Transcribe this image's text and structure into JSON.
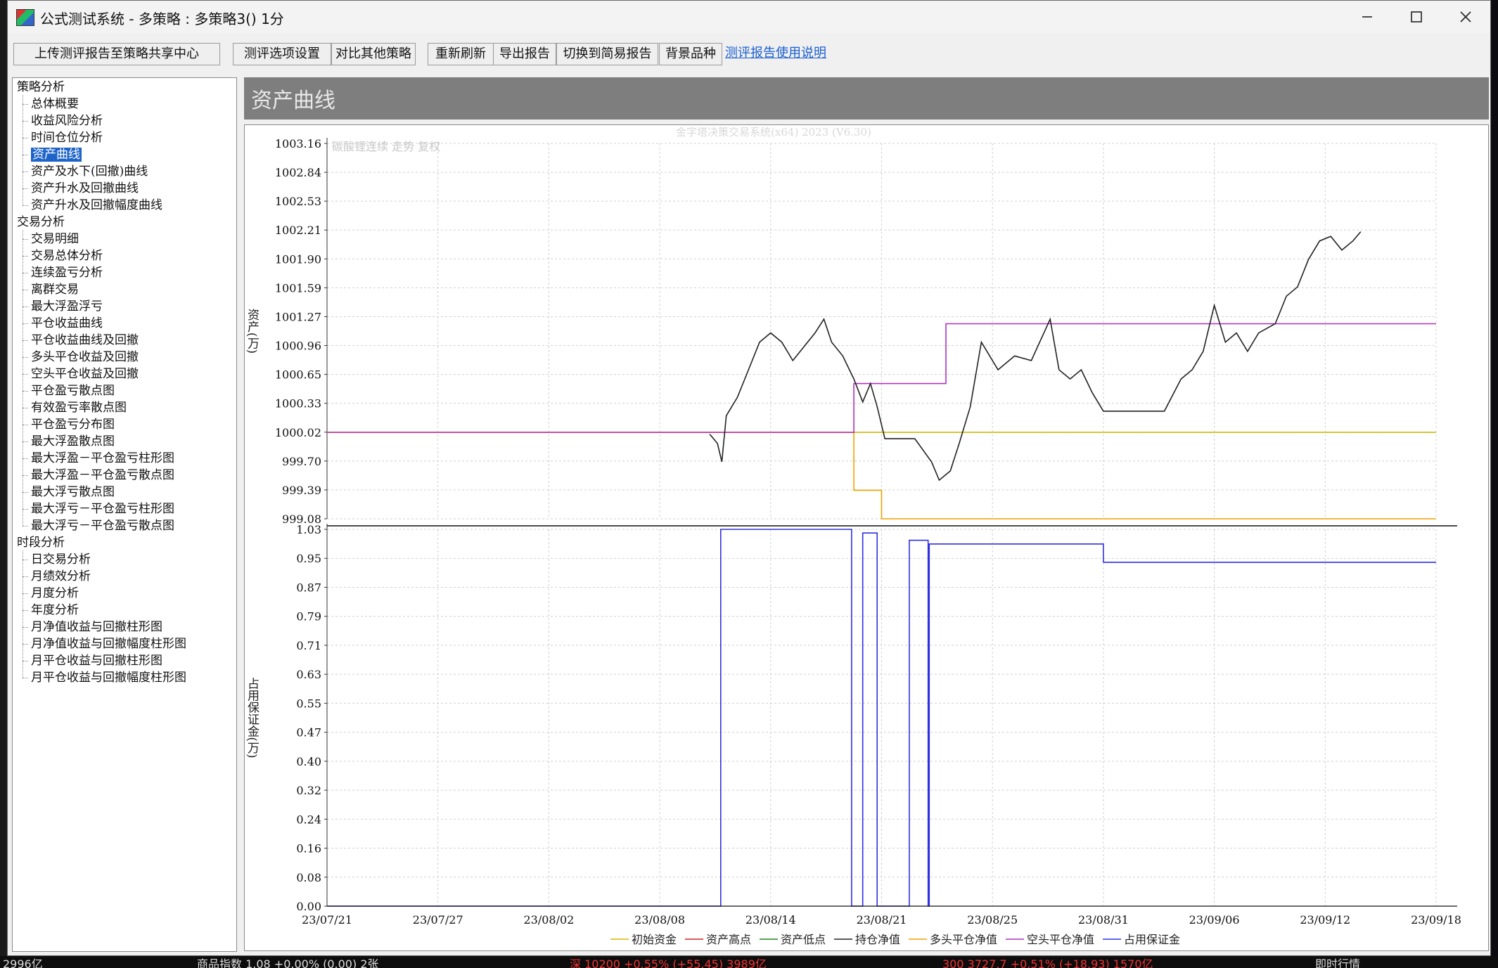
{
  "window": {
    "title": "公式测试系统 - 多策略 : 多策略3() 1分"
  },
  "toolbar": {
    "upload": "上传测评报告至策略共享中心",
    "options": "测评选项设置",
    "compare": "对比其他策略",
    "refresh": "重新刷新",
    "export": "导出报告",
    "simple": "切换到简易报告",
    "bgsymbol": "背景品种",
    "help": "测评报告使用说明"
  },
  "tree": [
    {
      "label": "策略分析",
      "level": 0
    },
    {
      "label": "总体概要",
      "level": 1
    },
    {
      "label": "收益风险分析",
      "level": 1
    },
    {
      "label": "时间仓位分析",
      "level": 1
    },
    {
      "label": "资产曲线",
      "level": 1,
      "selected": true
    },
    {
      "label": "资产及水下(回撤)曲线",
      "level": 1
    },
    {
      "label": "资产升水及回撤曲线",
      "level": 1
    },
    {
      "label": "资产升水及回撤幅度曲线",
      "level": 1
    },
    {
      "label": "交易分析",
      "level": 0
    },
    {
      "label": "交易明细",
      "level": 1
    },
    {
      "label": "交易总体分析",
      "level": 1
    },
    {
      "label": "连续盈亏分析",
      "level": 1
    },
    {
      "label": "离群交易",
      "level": 1
    },
    {
      "label": "最大浮盈浮亏",
      "level": 1
    },
    {
      "label": "平仓收益曲线",
      "level": 1
    },
    {
      "label": "平仓收益曲线及回撤",
      "level": 1
    },
    {
      "label": "多头平仓收益及回撤",
      "level": 1
    },
    {
      "label": "空头平仓收益及回撤",
      "level": 1
    },
    {
      "label": "平仓盈亏散点图",
      "level": 1
    },
    {
      "label": "有效盈亏率散点图",
      "level": 1
    },
    {
      "label": "平仓盈亏分布图",
      "level": 1
    },
    {
      "label": "最大浮盈散点图",
      "level": 1
    },
    {
      "label": "最大浮盈－平仓盈亏柱形图",
      "level": 1
    },
    {
      "label": "最大浮盈－平仓盈亏散点图",
      "level": 1
    },
    {
      "label": "最大浮亏散点图",
      "level": 1
    },
    {
      "label": "最大浮亏－平仓盈亏柱形图",
      "level": 1
    },
    {
      "label": "最大浮亏－平仓盈亏散点图",
      "level": 1
    },
    {
      "label": "时段分析",
      "level": 0
    },
    {
      "label": "日交易分析",
      "level": 1
    },
    {
      "label": "月绩效分析",
      "level": 1
    },
    {
      "label": "月度分析",
      "level": 1
    },
    {
      "label": "年度分析",
      "level": 1
    },
    {
      "label": "月净值收益与回撤柱形图",
      "level": 1
    },
    {
      "label": "月净值收益与回撤幅度柱形图",
      "level": 1
    },
    {
      "label": "月平仓收益与回撤柱形图",
      "level": 1
    },
    {
      "label": "月平仓收益与回撤幅度柱形图",
      "level": 1
    }
  ],
  "report": {
    "heading": "资产曲线"
  },
  "chart_data": {
    "type": "line",
    "watermark": "金字塔决策交易系统(x64) 2023 (V6.30)",
    "background_symbol": "碳酸锂连续 走势 复权",
    "x_ticks": [
      "23/07/21",
      "23/07/27",
      "23/08/02",
      "23/08/08",
      "23/08/14",
      "23/08/21",
      "23/08/25",
      "23/08/31",
      "23/09/06",
      "23/09/12",
      "23/09/18"
    ],
    "upper": {
      "ylabel": "资产(万)",
      "y_ticks": [
        "1003.16",
        "1002.84",
        "1002.53",
        "1002.21",
        "1001.90",
        "1001.59",
        "1001.27",
        "1000.96",
        "1000.65",
        "1000.33",
        "1000.02",
        "999.70",
        "999.39",
        "999.08"
      ],
      "ylim": [
        999.08,
        1003.16
      ],
      "series": [
        {
          "name": "初始资金",
          "color": "#c8b400",
          "points": [
            [
              0,
              1000.02
            ],
            [
              100,
              1000.02
            ]
          ]
        },
        {
          "name": "多头平仓净值",
          "color": "#f0a000",
          "points": [
            [
              0,
              1000.02
            ],
            [
              47.5,
              1000.02
            ],
            [
              47.5,
              999.39
            ],
            [
              50,
              999.39
            ],
            [
              50,
              999.08
            ],
            [
              100,
              999.08
            ]
          ]
        },
        {
          "name": "空头平仓净值",
          "color": "#b030c0",
          "points": [
            [
              0,
              1000.02
            ],
            [
              47.5,
              1000.02
            ],
            [
              47.5,
              1000.55
            ],
            [
              55.8,
              1000.55
            ],
            [
              55.8,
              1001.2
            ],
            [
              100,
              1001.2
            ]
          ]
        },
        {
          "name": "资产曲线",
          "color": "#222222",
          "points": [
            [
              34.5,
              1000.0
            ],
            [
              35.2,
              999.9
            ],
            [
              35.6,
              999.7
            ],
            [
              36,
              1000.2
            ],
            [
              37,
              1000.4
            ],
            [
              38,
              1000.7
            ],
            [
              39,
              1001.0
            ],
            [
              40,
              1001.1
            ],
            [
              41,
              1001.0
            ],
            [
              42,
              1000.8
            ],
            [
              43,
              1000.95
            ],
            [
              44,
              1001.1
            ],
            [
              44.8,
              1001.25
            ],
            [
              45.5,
              1001.0
            ],
            [
              46.5,
              1000.85
            ],
            [
              47.5,
              1000.6
            ],
            [
              48.3,
              1000.35
            ],
            [
              49,
              1000.55
            ],
            [
              49.6,
              1000.3
            ],
            [
              50.3,
              999.95
            ],
            [
              53,
              999.95
            ],
            [
              54.5,
              999.7
            ],
            [
              55.2,
              999.5
            ],
            [
              56.2,
              999.6
            ],
            [
              57,
              999.9
            ],
            [
              58,
              1000.3
            ],
            [
              59,
              1001.0
            ],
            [
              60.5,
              1000.7
            ],
            [
              62,
              1000.85
            ],
            [
              63.5,
              1000.8
            ],
            [
              65.2,
              1001.25
            ],
            [
              66,
              1000.7
            ],
            [
              67,
              1000.6
            ],
            [
              68,
              1000.7
            ],
            [
              69,
              1000.45
            ],
            [
              70,
              1000.25
            ],
            [
              75.5,
              1000.25
            ],
            [
              77,
              1000.6
            ],
            [
              78,
              1000.7
            ],
            [
              79,
              1000.9
            ],
            [
              80,
              1001.4
            ],
            [
              81,
              1001.0
            ],
            [
              82,
              1001.1
            ],
            [
              83,
              1000.9
            ],
            [
              84,
              1001.1
            ],
            [
              85.5,
              1001.2
            ],
            [
              86.5,
              1001.5
            ],
            [
              87.5,
              1001.6
            ],
            [
              88.5,
              1001.9
            ],
            [
              89.5,
              1002.1
            ],
            [
              90.5,
              1002.15
            ],
            [
              91.5,
              1002.0
            ],
            [
              92.5,
              1002.1
            ],
            [
              93.2,
              1002.2
            ]
          ]
        }
      ]
    },
    "lower": {
      "ylabel": "占用保证金(万)",
      "y_ticks": [
        "1.03",
        "0.95",
        "0.87",
        "0.79",
        "0.71",
        "0.63",
        "0.55",
        "0.47",
        "0.40",
        "0.32",
        "0.24",
        "0.16",
        "0.08",
        "0.00"
      ],
      "ylim": [
        0,
        1.03
      ],
      "series": [
        {
          "name": "占用保证金",
          "color": "#3030e0",
          "points": [
            [
              0,
              0
            ],
            [
              35.5,
              0
            ],
            [
              35.5,
              1.03
            ],
            [
              47.3,
              1.03
            ],
            [
              47.3,
              0
            ],
            [
              48.3,
              0
            ],
            [
              48.3,
              1.02
            ],
            [
              49.6,
              1.02
            ],
            [
              49.6,
              0
            ],
            [
              52.5,
              0
            ],
            [
              52.5,
              1.0
            ],
            [
              54.2,
              1.0
            ],
            [
              54.2,
              0
            ],
            [
              54.3,
              0
            ],
            [
              54.3,
              0.99
            ],
            [
              70,
              0.99
            ],
            [
              70,
              0.94
            ],
            [
              100,
              0.94
            ]
          ]
        }
      ]
    },
    "legend": [
      "初始资金",
      "资产高点",
      "资产低点",
      "持仓净值",
      "多头平仓净值",
      "空头平仓净值",
      "占用保证金"
    ],
    "legend_colors": [
      "#e0b000",
      "#d02020",
      "#208020",
      "#222222",
      "#f0a000",
      "#b030c0",
      "#3030e0"
    ],
    "legend_position": "bottom"
  },
  "statusbar": {
    "s1": "2996亿",
    "s2": "商品指数 1.08 +0.00% (0.00) 2张",
    "s3": "深 10200 +0.55% (+55.45) 3989亿",
    "s4": "300 3727.7 +0.51% (+18.93) 1570亿",
    "s5": "即时行情"
  },
  "colors": {
    "selection": "#1e64c8",
    "report_header": "#7e7e7e",
    "link": "#1a5fd0"
  }
}
